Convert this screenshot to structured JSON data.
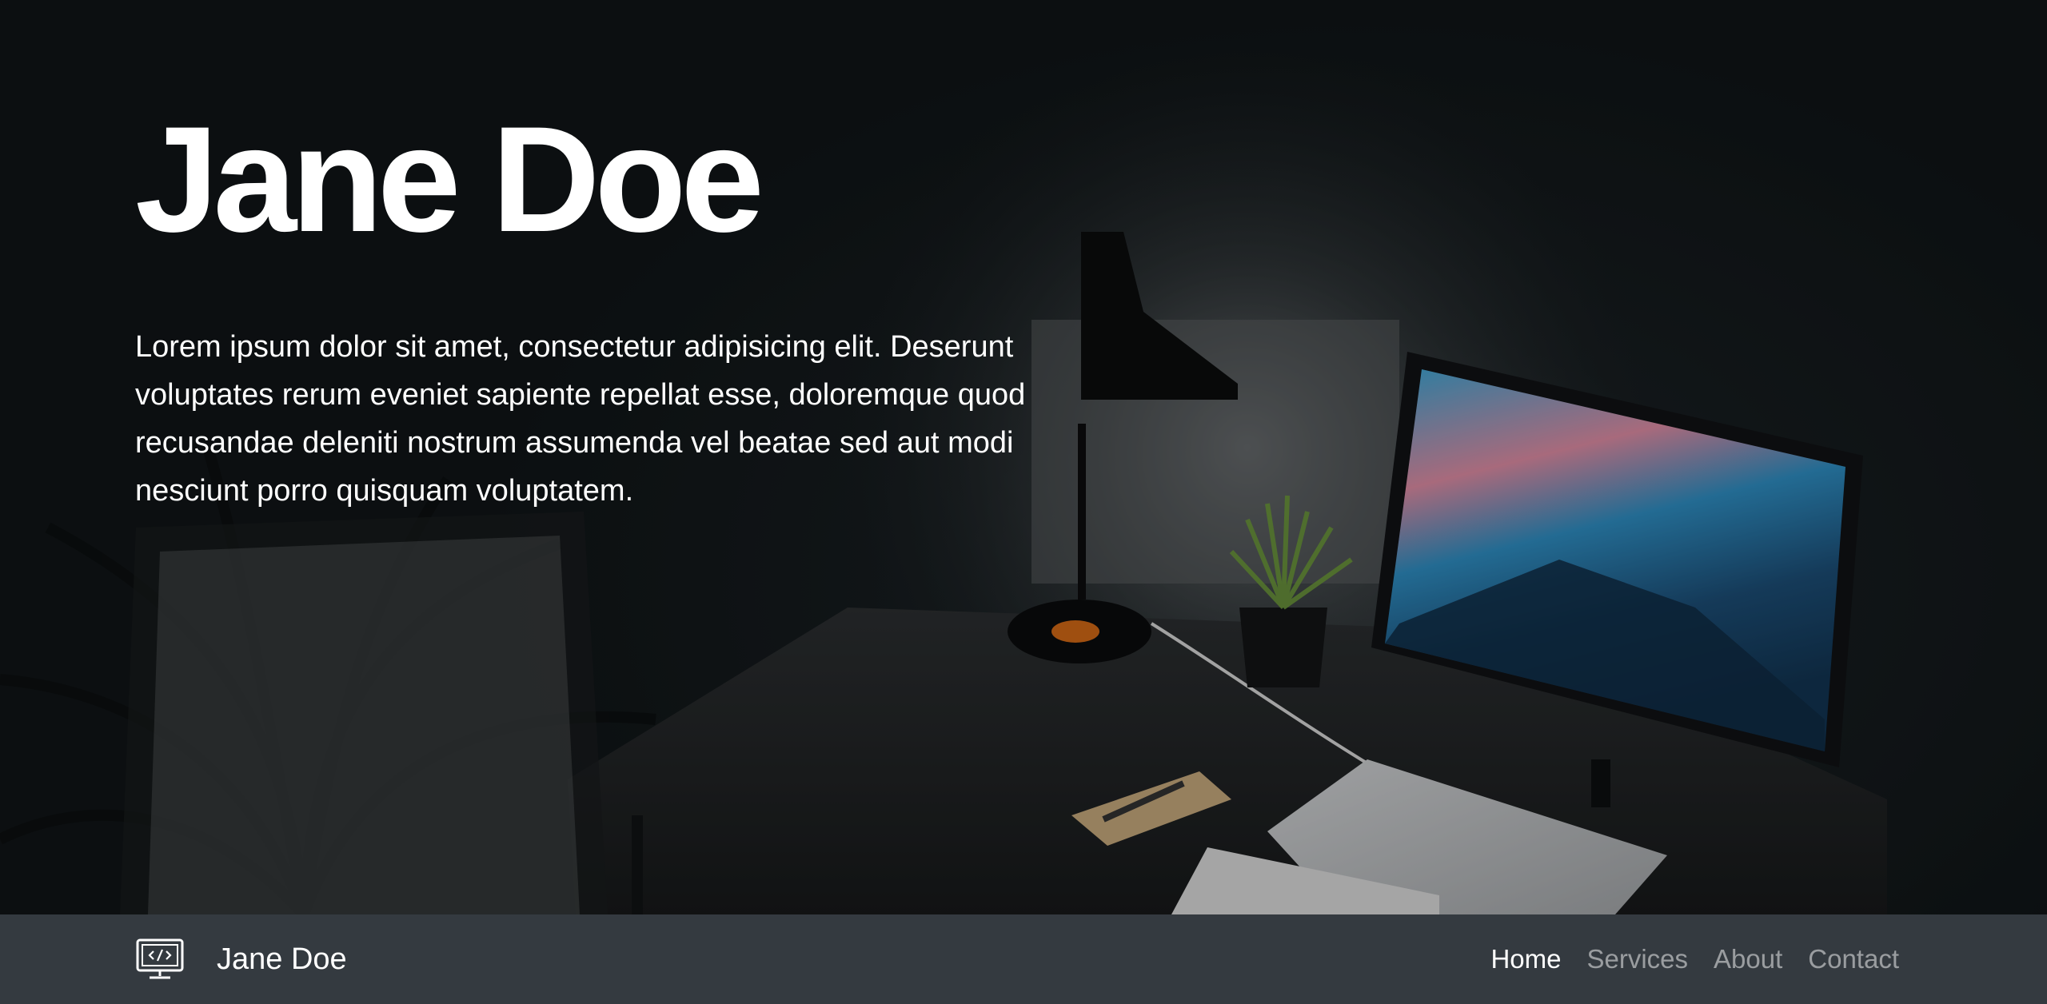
{
  "hero": {
    "title": "Jane Doe",
    "text": "Lorem ipsum dolor sit amet, consectetur adipisicing elit. Deserunt voluptates rerum eveniet sapiente repellat esse, doloremque quod recusandae deleniti nostrum assumenda vel beatae sed aut modi nesciunt porro quisquam voluptatem."
  },
  "navbar": {
    "brand_icon": "code-monitor-icon",
    "brand_name": "Jane Doe",
    "links": [
      {
        "label": "Home",
        "active": true
      },
      {
        "label": "Services",
        "active": false
      },
      {
        "label": "About",
        "active": false
      },
      {
        "label": "Contact",
        "active": false
      }
    ],
    "background": "#343a40"
  },
  "colors": {
    "text_primary": "#ffffff",
    "nav_inactive": "rgba(255,255,255,0.5)"
  }
}
